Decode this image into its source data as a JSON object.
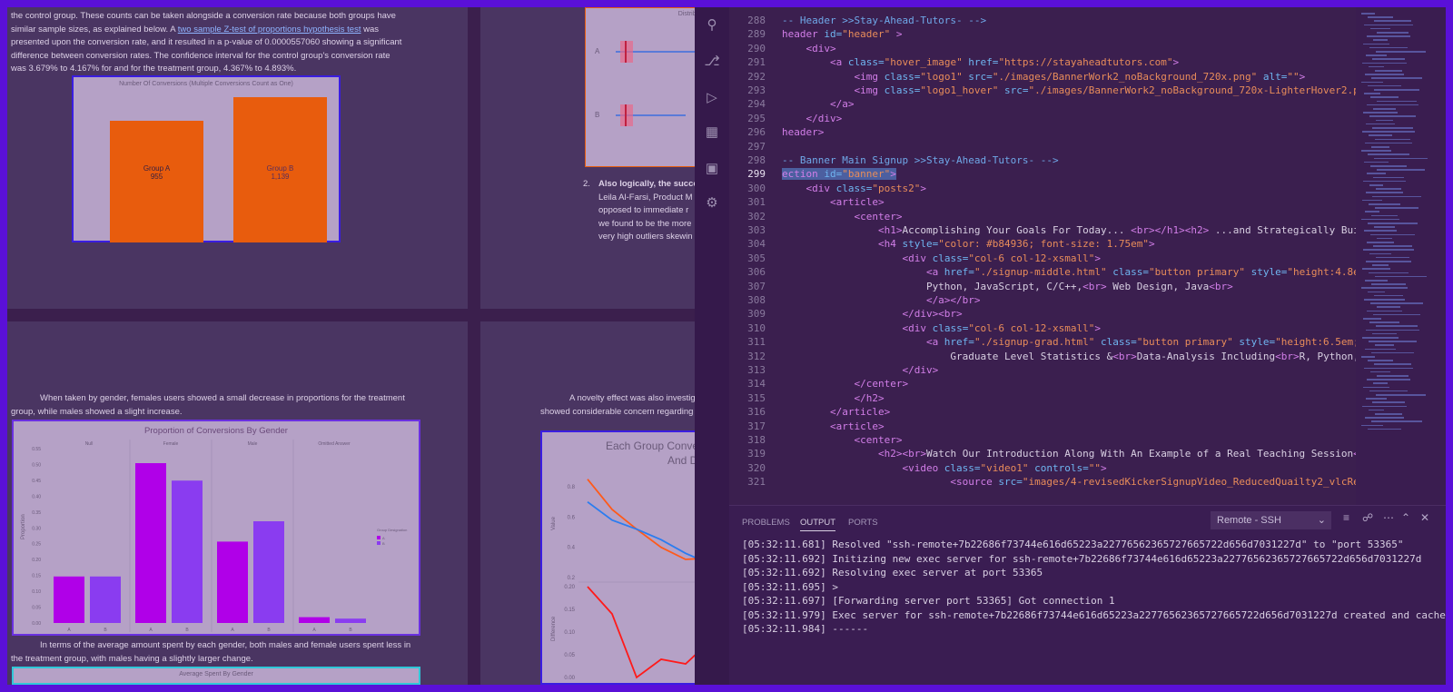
{
  "document": {
    "para1": [
      "the control group.  These counts can be taken alongside a conversion rate because both groups have",
      "similar sample sizes, as explained below.  A",
      "two sample Z-test of proportions hypothesis test",
      "was",
      "presented upon the conversion rate, and it resulted in a p-value of 0.0000557060 showing a significant",
      "difference between conversion rates.  The confidence interval for the control group's conversion rate",
      "was 3.679% to 4.167% for and for the treatment group, 4.367% to 4.893%."
    ],
    "chart1": {
      "title": "Number Of Conversions (Multiple Conversions Count as One)",
      "group_a_label": "Group A",
      "group_a_value": "955",
      "group_b_label": "Group B",
      "group_b_value": "1,139"
    },
    "chart2_title": "Distributi",
    "chart2_a": "A",
    "chart2_b": "B",
    "para2_number": "2.",
    "para2": [
      "Also logically, the succes",
      "Leila Al-Farsi, Product M",
      "opposed to immediate r",
      "we found to be the more",
      "very high outliers skewin"
    ],
    "para3": [
      "When taken by gender, females users showed a small decrease in proportions for the treatment",
      "group, while males showed a slight increase."
    ],
    "para4": [
      "A novelty effect was also investig",
      "showed considerable concern regarding t"
    ],
    "para5": [
      "In terms of the average amount spent by each gender, both males and female users spent less in",
      "the treatment group, with males having a slightly larger change."
    ],
    "chart5_title": "Average Spent By Gender",
    "chart4_title_line1": "Each Group Conve",
    "chart4_title_line2": "And Differ",
    "chart4_ylabel_top": "Value",
    "chart4_ylabel_bottom": "Difference"
  },
  "chart_data": [
    {
      "type": "bar",
      "title": "Number Of Conversions (Multiple Conversions Count as One)",
      "categories": [
        "Group A",
        "Group B"
      ],
      "values": [
        955,
        1139
      ],
      "ylim": [
        0,
        1200
      ]
    },
    {
      "type": "bar",
      "title": "Proportion of Conversions By Gender",
      "categories": [
        "Null",
        "Female",
        "Male",
        "Omitted Answer"
      ],
      "series": [
        {
          "name": "A",
          "values": [
            0.16,
            0.55,
            0.28,
            0.02
          ]
        },
        {
          "name": "B",
          "values": [
            0.16,
            0.49,
            0.35,
            0.015
          ]
        }
      ],
      "ylabel": "Proportion",
      "ylim": [
        0,
        0.6
      ],
      "yticks": [
        "0.55",
        "0.50",
        "0.45",
        "0.40",
        "0.35",
        "0.30",
        "0.25",
        "0.20",
        "0.15",
        "0.10",
        "0.05",
        "0.00"
      ],
      "legend": "right",
      "legend_title": "Group Designation"
    },
    {
      "type": "line",
      "title": "Each Group Conve And Differ",
      "yticks_top": [
        "0.8",
        "0.6",
        "0.4",
        "0.2"
      ],
      "yticks_bottom": [
        "0.20",
        "0.15",
        "0.10",
        "0.05",
        "0.00"
      ],
      "series": [
        {
          "name": "",
          "color": "#ff5a1a",
          "values": [
            0.85,
            0.65,
            0.52,
            0.4,
            0.32,
            0.33
          ]
        },
        {
          "name": "",
          "color": "#2a7cf0",
          "values": [
            0.7,
            0.58,
            0.52,
            0.45,
            0.36,
            0.29
          ]
        },
        {
          "name": "",
          "color": "#ff1a1a",
          "values": [
            0.2,
            0.14,
            0.0,
            0.04,
            0.03,
            0.08
          ]
        }
      ]
    }
  ],
  "vscode": {
    "lines": [
      {
        "n": "288",
        "parts": [
          [
            "t-cmt",
            "-- Header >>Stay-Ahead-Tutors- -->"
          ]
        ]
      },
      {
        "n": "289",
        "parts": [
          [
            "t-tag",
            "header"
          ],
          [
            "t-attr",
            " id="
          ],
          [
            "t-str",
            "\"header\""
          ],
          [
            "t-tag",
            " >"
          ]
        ]
      },
      {
        "n": "290",
        "parts": [
          [
            "t-tag",
            "    <div>"
          ]
        ]
      },
      {
        "n": "291",
        "parts": [
          [
            "t-tag",
            "        <a"
          ],
          [
            "t-attr",
            " class="
          ],
          [
            "t-str",
            "\"hover_image\""
          ],
          [
            "t-attr",
            " href="
          ],
          [
            "t-str",
            "\"https://stayaheadtutors.com\""
          ],
          [
            "t-tag",
            ">"
          ]
        ]
      },
      {
        "n": "292",
        "parts": [
          [
            "t-tag",
            "            <img"
          ],
          [
            "t-attr",
            " class="
          ],
          [
            "t-str",
            "\"logo1\""
          ],
          [
            "t-attr",
            " src="
          ],
          [
            "t-str",
            "\"./images/BannerWork2_noBackground_720x.png\""
          ],
          [
            "t-attr",
            " alt="
          ],
          [
            "t-str",
            "\"\""
          ],
          [
            "t-tag",
            ">"
          ]
        ]
      },
      {
        "n": "293",
        "parts": [
          [
            "t-tag",
            "            <img"
          ],
          [
            "t-attr",
            " class="
          ],
          [
            "t-str",
            "\"logo1_hover\""
          ],
          [
            "t-attr",
            " src="
          ],
          [
            "t-str",
            "\"./images/BannerWork2_noBackground_720x-LighterHover2.png\""
          ],
          [
            "t-attr",
            " alt"
          ]
        ]
      },
      {
        "n": "294",
        "parts": [
          [
            "t-tag",
            "        </a>"
          ]
        ]
      },
      {
        "n": "295",
        "parts": [
          [
            "t-tag",
            "    </div>"
          ]
        ]
      },
      {
        "n": "296",
        "parts": [
          [
            "t-tag",
            "header>"
          ]
        ]
      },
      {
        "n": "297",
        "parts": []
      },
      {
        "n": "298",
        "parts": [
          [
            "t-cmt",
            "-- Banner Main Signup >>Stay-Ahead-Tutors- -->"
          ]
        ]
      },
      {
        "n": "299",
        "parts": [
          [
            "t-tag hl",
            "ection"
          ],
          [
            "t-attr hl",
            " id="
          ],
          [
            "t-str hl",
            "\"banner\""
          ],
          [
            "t-tag hl",
            ">"
          ]
        ]
      },
      {
        "n": "300",
        "parts": [
          [
            "t-tag",
            "    <div"
          ],
          [
            "t-attr",
            " class="
          ],
          [
            "t-str",
            "\"posts2\""
          ],
          [
            "t-tag",
            ">"
          ]
        ]
      },
      {
        "n": "301",
        "parts": [
          [
            "t-tag",
            "        <article>"
          ]
        ]
      },
      {
        "n": "302",
        "parts": [
          [
            "t-tag",
            "            <center>"
          ]
        ]
      },
      {
        "n": "303",
        "parts": [
          [
            "t-tag",
            "                <h1>"
          ],
          [
            "t-txt",
            "Accomplishing Your Goals For Today... "
          ],
          [
            "t-tag",
            "<br></h1><h2>"
          ],
          [
            "t-txt",
            " ...and Strategically Building F"
          ]
        ]
      },
      {
        "n": "304",
        "parts": [
          [
            "t-tag",
            "                <h4"
          ],
          [
            "t-attr",
            " style="
          ],
          [
            "t-str",
            "\"color: #b84936; font-size: 1.75em\""
          ],
          [
            "t-tag",
            ">"
          ]
        ]
      },
      {
        "n": "305",
        "parts": [
          [
            "t-tag",
            "                    <div"
          ],
          [
            "t-attr",
            " class="
          ],
          [
            "t-str",
            "\"col-6 col-12-xsmall\""
          ],
          [
            "t-tag",
            ">"
          ]
        ]
      },
      {
        "n": "306",
        "parts": [
          [
            "t-tag",
            "                        <a"
          ],
          [
            "t-attr",
            " href="
          ],
          [
            "t-str",
            "\"./signup-middle.html\""
          ],
          [
            "t-attr",
            " class="
          ],
          [
            "t-str",
            "\"button primary\""
          ],
          [
            "t-attr",
            " style="
          ],
          [
            "t-str",
            "\"height:4.8em; widt"
          ]
        ]
      },
      {
        "n": "307",
        "parts": [
          [
            "t-txt",
            "                        Python, JavaScript, C/C++,"
          ],
          [
            "t-tag",
            "<br>"
          ],
          [
            "t-txt",
            " Web Design, Java"
          ],
          [
            "t-tag",
            "<br>"
          ]
        ]
      },
      {
        "n": "308",
        "parts": [
          [
            "t-tag",
            "                        </a></br>"
          ]
        ]
      },
      {
        "n": "309",
        "parts": [
          [
            "t-tag",
            "                    </div><br>"
          ]
        ]
      },
      {
        "n": "310",
        "parts": [
          [
            "t-tag",
            "                    <div"
          ],
          [
            "t-attr",
            " class="
          ],
          [
            "t-str",
            "\"col-6 col-12-xsmall\""
          ],
          [
            "t-tag",
            ">"
          ]
        ]
      },
      {
        "n": "311",
        "parts": [
          [
            "t-tag",
            "                        <a"
          ],
          [
            "t-attr",
            " href="
          ],
          [
            "t-str",
            "\"./signup-grad.html\""
          ],
          [
            "t-attr",
            " class="
          ],
          [
            "t-str",
            "\"button primary\""
          ],
          [
            "t-attr",
            " style="
          ],
          [
            "t-str",
            "\"height:6.5em; width:"
          ]
        ]
      },
      {
        "n": "312",
        "parts": [
          [
            "t-txt",
            "                            Graduate Level Statistics &"
          ],
          [
            "t-tag",
            "<br>"
          ],
          [
            "t-txt",
            "Data-Analysis Including"
          ],
          [
            "t-tag",
            "<br>"
          ],
          [
            "t-txt",
            "R, Python, Databa"
          ]
        ]
      },
      {
        "n": "313",
        "parts": [
          [
            "t-tag",
            "                    </div>"
          ]
        ]
      },
      {
        "n": "314",
        "parts": [
          [
            "t-tag",
            "            </center>"
          ]
        ]
      },
      {
        "n": "315",
        "parts": [
          [
            "t-tag",
            "            </h2>"
          ]
        ]
      },
      {
        "n": "316",
        "parts": [
          [
            "t-tag",
            "        </article>"
          ]
        ]
      },
      {
        "n": "317",
        "parts": [
          [
            "t-tag",
            "        <article>"
          ]
        ]
      },
      {
        "n": "318",
        "parts": [
          [
            "t-tag",
            "            <center>"
          ]
        ]
      },
      {
        "n": "319",
        "parts": [
          [
            "t-tag",
            "                <h2><br>"
          ],
          [
            "t-txt",
            "Watch Our Introduction Along With An Example of a Real Teaching Session"
          ],
          [
            "t-tag",
            "</h2>"
          ]
        ]
      },
      {
        "n": "320",
        "parts": [
          [
            "t-tag",
            "                    <video"
          ],
          [
            "t-attr",
            " class="
          ],
          [
            "t-str",
            "\"video1\""
          ],
          [
            "t-attr",
            " controls="
          ],
          [
            "t-str",
            "\"\""
          ],
          [
            "t-tag",
            ">"
          ]
        ]
      },
      {
        "n": "321",
        "parts": [
          [
            "t-tag",
            "                            <source"
          ],
          [
            "t-attr",
            " src="
          ],
          [
            "t-str",
            "\"images/4-revisedKickerSignupVideo_ReducedQuailty2_vlcReformatm"
          ]
        ]
      }
    ],
    "panel": {
      "tabs": [
        "PROBLEMS",
        "OUTPUT",
        "PORTS"
      ],
      "active_tab": "OUTPUT",
      "select_value": "Remote - SSH",
      "output": [
        "[05:32:11.681] Resolved \"ssh-remote+7b22686f73744e616d65223a22776562365727665722d656d7031227d\" to \"port 53365\"",
        "[05:32:11.692] Initizing new exec server for ssh-remote+7b22686f73744e616d65223a22776562365727665722d656d7031227d",
        "[05:32:11.692] Resolving exec server at port 53365",
        "[05:32:11.695] >",
        "[05:32:11.697] [Forwarding server port 53365] Got connection 1",
        "[05:32:11.979] Exec server for ssh-remote+7b22686f73744e616d65223a22776562365727665722d656d7031227d created and cached",
        "[05:32:11.984] ------"
      ]
    }
  }
}
